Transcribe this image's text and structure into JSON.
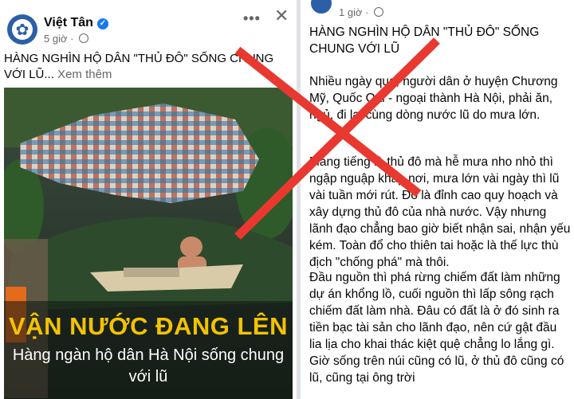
{
  "left_post": {
    "page_name": "Việt Tân",
    "time": "5 giờ",
    "dots": "•••",
    "close": "✕",
    "caption": "HÀNG NGHÌN HỘ DÂN \"THỦ ĐÔ\" SỐNG CHUNG VỚI LŨ...",
    "see_more": "Xem thêm",
    "image_title": "VẬN NƯỚC ĐANG LÊN",
    "image_subtitle": "Hàng ngàn hộ dân Hà Nội sống chung với lũ"
  },
  "right_post": {
    "time": "1 giờ",
    "title": "HÀNG NGHÌN HỘ DÂN \"THỦ ĐÔ\" SỐNG CHUNG VỚI LŨ",
    "paragraph1": "Nhiều ngày qua, người dân ở huyện Chương Mỹ, Quốc Oai - ngoại thành Hà Nội, phải ăn, ngủ, đi lại cùng dòng nước lũ do mưa lớn.",
    "paragraph2": "Mang tiếng là thủ đô mà hễ mưa nho nhỏ thì ngập nguập khắp nơi, mưa lớn vài ngày thì lũ vài tuần mới rút. Đó là đỉnh cao quy hoạch và xây dựng thủ đô của nhà nước. Vậy nhưng lãnh đạo chẳng bao giờ biết nhận sai, nhận yếu kém. Toàn đổ cho thiên tai hoặc là thế lực thù địch \"chống phá\" mà thôi.",
    "paragraph3": "Đầu nguồn thì phá rừng chiếm đất làm những dự án khổng lồ, cuối nguồn thì lấp sông rạch chiếm đất làm nhà. Đâu có đất là ở đó sinh ra tiền bạc tài sản cho lãnh đạo, nên cứ gật đầu lia lịa cho khai thác kiệt quệ chẳng lo lắng gì. Giờ sống trên núi cũng có lũ, ở thủ đô cũng có lũ, cũng tại ông trời"
  },
  "colors": {
    "cross": "#e8382f",
    "brand": "#2c5fa8",
    "verified": "#1877f2",
    "headline": "#f3c300"
  },
  "icons": [
    "verified-icon",
    "globe-icon",
    "more-icon",
    "close-icon",
    "cross-mark-icon"
  ]
}
